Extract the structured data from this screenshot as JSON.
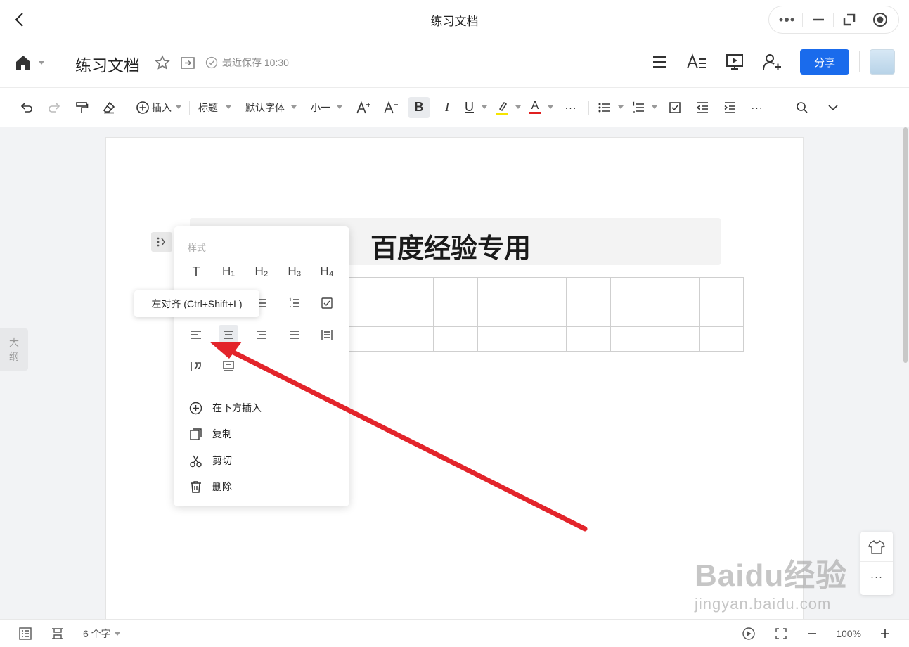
{
  "window": {
    "title": "练习文档"
  },
  "doc": {
    "title": "练习文档",
    "save_status": "最近保存 10:30"
  },
  "header": {
    "share_label": "分享"
  },
  "toolbar": {
    "insert_label": "插入",
    "heading_label": "标题",
    "font_label": "默认字体",
    "size_label": "小一",
    "bold_label": "B",
    "italic_label": "I",
    "underline_label": "U",
    "font_color_label": "A",
    "more_label": "···",
    "highlight_color": "#f5e400",
    "font_color": "#e02020"
  },
  "outline": {
    "label_line1": "大",
    "label_line2": "纲"
  },
  "content": {
    "heading": "百度经验专用",
    "table_rows": 3,
    "table_cols": 9
  },
  "menu": {
    "section_title": "样式",
    "styles": [
      "T",
      "H₁",
      "H₂",
      "H₃",
      "H₄"
    ],
    "items": [
      {
        "label": "在下方插入",
        "icon": "plus-circle-icon"
      },
      {
        "label": "复制",
        "icon": "copy-icon"
      },
      {
        "label": "剪切",
        "icon": "scissors-icon"
      },
      {
        "label": "删除",
        "icon": "trash-icon"
      }
    ]
  },
  "tooltip": {
    "text": "左对齐 (Ctrl+Shift+L)"
  },
  "float_panel": {
    "more_label": "···"
  },
  "statusbar": {
    "word_count": "6 个字",
    "zoom": "100%"
  },
  "watermark": {
    "logo": "Baidu经验",
    "url": "jingyan.baidu.com"
  },
  "colors": {
    "accent": "#1a6bec",
    "arrow": "#e3242b"
  }
}
